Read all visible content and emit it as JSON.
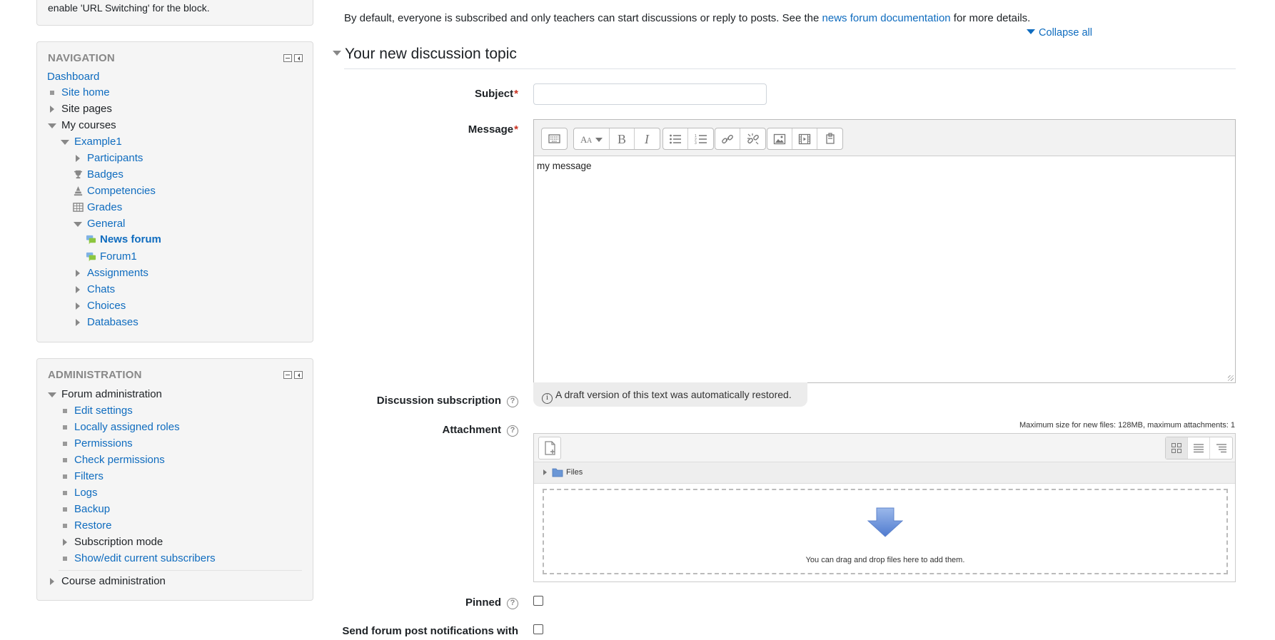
{
  "top_block": {
    "text": "enable 'URL Switching' for the block."
  },
  "navigation": {
    "title": "NAVIGATION",
    "items": [
      {
        "label": "Dashboard"
      },
      {
        "label": "Site home"
      },
      {
        "label": "Site pages"
      },
      {
        "label": "My courses"
      },
      {
        "label": "Example1"
      },
      {
        "label": "Participants"
      },
      {
        "label": "Badges"
      },
      {
        "label": "Competencies"
      },
      {
        "label": "Grades"
      },
      {
        "label": "General"
      },
      {
        "label": "News forum"
      },
      {
        "label": "Forum1"
      },
      {
        "label": "Assignments"
      },
      {
        "label": "Chats"
      },
      {
        "label": "Choices"
      },
      {
        "label": "Databases"
      }
    ]
  },
  "administration": {
    "title": "ADMINISTRATION",
    "items": [
      {
        "label": "Forum administration"
      },
      {
        "label": "Edit settings"
      },
      {
        "label": "Locally assigned roles"
      },
      {
        "label": "Permissions"
      },
      {
        "label": "Check permissions"
      },
      {
        "label": "Filters"
      },
      {
        "label": "Logs"
      },
      {
        "label": "Backup"
      },
      {
        "label": "Restore"
      },
      {
        "label": "Subscription mode"
      },
      {
        "label": "Show/edit current subscribers"
      },
      {
        "label": "Course administration"
      }
    ]
  },
  "main": {
    "intro_before": "By default, everyone is subscribed and only teachers can start discussions or reply to posts. See the ",
    "intro_link": "news forum documentation",
    "intro_after": " for more details.",
    "collapse_all": "Collapse all",
    "section_title": "Your new discussion topic",
    "required_mark": "*",
    "subject_label": "Subject",
    "subject_value": "",
    "message_label": "Message",
    "message_value": "my message",
    "draft_notice": "A draft version of this text was automatically restored.",
    "subscription_label": "Discussion subscription",
    "attachment_label": "Attachment",
    "max_size": "Maximum size for new files: 128MB, maximum attachments: 1",
    "files_folder": "Files",
    "drop_hint": "You can drag and drop files here to add them.",
    "pinned_label": "Pinned",
    "notify_label": "Send forum post notifications with"
  },
  "colors": {
    "link": "#0f6cbf",
    "required": "#ca3120",
    "block_bg": "#f5f5f5"
  }
}
